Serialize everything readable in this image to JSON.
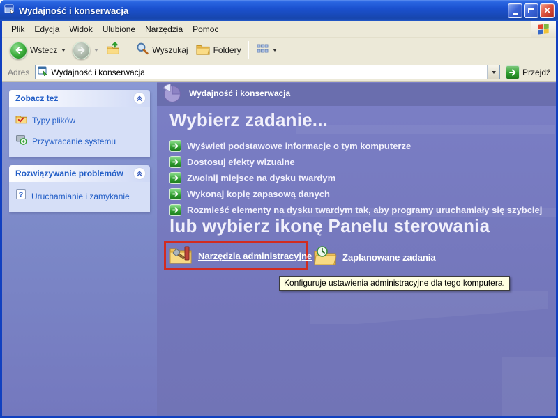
{
  "window": {
    "title": "Wydajność i konserwacja"
  },
  "menu": {
    "items": [
      "Plik",
      "Edycja",
      "Widok",
      "Ulubione",
      "Narzędzia",
      "Pomoc"
    ]
  },
  "toolbar": {
    "back": "Wstecz",
    "search": "Wyszukaj",
    "folders": "Foldery"
  },
  "address": {
    "label": "Adres",
    "value": "Wydajność i konserwacja",
    "go": "Przejdź"
  },
  "sidebar": {
    "panels": [
      {
        "title": "Zobacz też",
        "items": [
          "Typy plików",
          "Przywracanie systemu"
        ]
      },
      {
        "title": "Rozwiązywanie problemów",
        "items": [
          "Uruchamianie i zamykanie"
        ]
      }
    ]
  },
  "main": {
    "page_title": "Wydajność i konserwacja",
    "heading_tasks": "Wybierz zadanie...",
    "tasks": [
      "Wyświetl podstawowe informacje o tym komputerze",
      "Dostosuj efekty wizualne",
      "Zwolnij miejsce na dysku twardym",
      "Wykonaj kopię zapasową danych",
      "Rozmieść elementy na dysku twardym tak, aby programy uruchamiały się szybciej"
    ],
    "heading_icons": "lub wybierz ikonę Panelu sterowania",
    "icons": [
      {
        "label": "Narzędzia administracyjne"
      },
      {
        "label": "Zaplanowane zadania"
      }
    ],
    "tooltip": "Konfiguruje ustawienia administracyjne dla tego komputera."
  },
  "colors": {
    "titlebar_blue": "#1b51cf",
    "window_border_blue": "#1140c0",
    "content_purple": "#7478bf",
    "header_strip_purple": "#6a6eae",
    "sidebar_panel_body": "#d6dff7",
    "panel_text_blue": "#215dc6",
    "highlight_red": "#d22b20",
    "tooltip_bg": "#ffffe1",
    "task_arrow_green": "#2f9e2f",
    "go_green": "#2f9e2f",
    "close_red": "#dd5440"
  }
}
